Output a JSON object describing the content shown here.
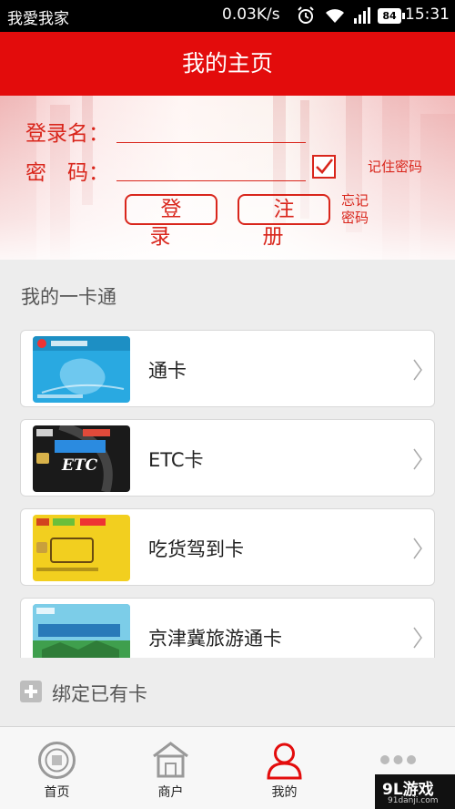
{
  "status_bar": {
    "carrier": "我愛我家",
    "speed": "0.03K/s",
    "battery": "84",
    "time": "15:31",
    "icons": [
      "alarm-icon",
      "wifi-icon",
      "signal-icon",
      "battery-icon"
    ]
  },
  "header": {
    "title": "我的主页"
  },
  "login": {
    "username_label": "登录名：",
    "username_value": "",
    "password_label": "密　码：",
    "password_value": "",
    "remember_label": "记住密码",
    "remember_checked": true,
    "login_button": "登录",
    "register_button": "注册",
    "forgot_line1": "忘记",
    "forgot_line2": "密码"
  },
  "section": {
    "title": "我的一卡通",
    "cards": [
      {
        "name": "通卡",
        "thumb_color": "#29a9e1"
      },
      {
        "name": "ETC卡",
        "thumb_color": "#1a1a1a"
      },
      {
        "name": "吃货驾到卡",
        "thumb_color": "#f2cf1f"
      },
      {
        "name": "京津冀旅游通卡",
        "thumb_color": "#4ab8d8"
      }
    ]
  },
  "bind_card": {
    "label": "绑定已有卡"
  },
  "bottom_nav": {
    "tabs": [
      {
        "label": "首页",
        "icon": "home-coin-icon"
      },
      {
        "label": "商户",
        "icon": "shop-icon"
      },
      {
        "label": "我的",
        "icon": "person-icon",
        "active": true
      },
      {
        "label": "",
        "icon": "more-icon"
      }
    ]
  },
  "watermark": {
    "brand": "9L游戏",
    "url": "91danji.com"
  },
  "colors": {
    "accent": "#e30c0c",
    "login_red": "#d9261c",
    "background": "#ededed"
  }
}
